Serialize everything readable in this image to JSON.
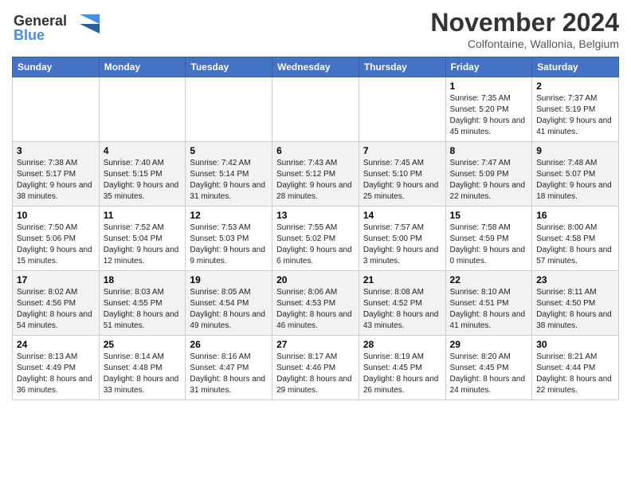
{
  "header": {
    "logo_line1": "General",
    "logo_line2": "Blue",
    "month": "November 2024",
    "location": "Colfontaine, Wallonia, Belgium"
  },
  "columns": [
    "Sunday",
    "Monday",
    "Tuesday",
    "Wednesday",
    "Thursday",
    "Friday",
    "Saturday"
  ],
  "weeks": [
    [
      {
        "day": "",
        "info": ""
      },
      {
        "day": "",
        "info": ""
      },
      {
        "day": "",
        "info": ""
      },
      {
        "day": "",
        "info": ""
      },
      {
        "day": "",
        "info": ""
      },
      {
        "day": "1",
        "info": "Sunrise: 7:35 AM\nSunset: 5:20 PM\nDaylight: 9 hours and 45 minutes."
      },
      {
        "day": "2",
        "info": "Sunrise: 7:37 AM\nSunset: 5:19 PM\nDaylight: 9 hours and 41 minutes."
      }
    ],
    [
      {
        "day": "3",
        "info": "Sunrise: 7:38 AM\nSunset: 5:17 PM\nDaylight: 9 hours and 38 minutes."
      },
      {
        "day": "4",
        "info": "Sunrise: 7:40 AM\nSunset: 5:15 PM\nDaylight: 9 hours and 35 minutes."
      },
      {
        "day": "5",
        "info": "Sunrise: 7:42 AM\nSunset: 5:14 PM\nDaylight: 9 hours and 31 minutes."
      },
      {
        "day": "6",
        "info": "Sunrise: 7:43 AM\nSunset: 5:12 PM\nDaylight: 9 hours and 28 minutes."
      },
      {
        "day": "7",
        "info": "Sunrise: 7:45 AM\nSunset: 5:10 PM\nDaylight: 9 hours and 25 minutes."
      },
      {
        "day": "8",
        "info": "Sunrise: 7:47 AM\nSunset: 5:09 PM\nDaylight: 9 hours and 22 minutes."
      },
      {
        "day": "9",
        "info": "Sunrise: 7:48 AM\nSunset: 5:07 PM\nDaylight: 9 hours and 18 minutes."
      }
    ],
    [
      {
        "day": "10",
        "info": "Sunrise: 7:50 AM\nSunset: 5:06 PM\nDaylight: 9 hours and 15 minutes."
      },
      {
        "day": "11",
        "info": "Sunrise: 7:52 AM\nSunset: 5:04 PM\nDaylight: 9 hours and 12 minutes."
      },
      {
        "day": "12",
        "info": "Sunrise: 7:53 AM\nSunset: 5:03 PM\nDaylight: 9 hours and 9 minutes."
      },
      {
        "day": "13",
        "info": "Sunrise: 7:55 AM\nSunset: 5:02 PM\nDaylight: 9 hours and 6 minutes."
      },
      {
        "day": "14",
        "info": "Sunrise: 7:57 AM\nSunset: 5:00 PM\nDaylight: 9 hours and 3 minutes."
      },
      {
        "day": "15",
        "info": "Sunrise: 7:58 AM\nSunset: 4:59 PM\nDaylight: 9 hours and 0 minutes."
      },
      {
        "day": "16",
        "info": "Sunrise: 8:00 AM\nSunset: 4:58 PM\nDaylight: 8 hours and 57 minutes."
      }
    ],
    [
      {
        "day": "17",
        "info": "Sunrise: 8:02 AM\nSunset: 4:56 PM\nDaylight: 8 hours and 54 minutes."
      },
      {
        "day": "18",
        "info": "Sunrise: 8:03 AM\nSunset: 4:55 PM\nDaylight: 8 hours and 51 minutes."
      },
      {
        "day": "19",
        "info": "Sunrise: 8:05 AM\nSunset: 4:54 PM\nDaylight: 8 hours and 49 minutes."
      },
      {
        "day": "20",
        "info": "Sunrise: 8:06 AM\nSunset: 4:53 PM\nDaylight: 8 hours and 46 minutes."
      },
      {
        "day": "21",
        "info": "Sunrise: 8:08 AM\nSunset: 4:52 PM\nDaylight: 8 hours and 43 minutes."
      },
      {
        "day": "22",
        "info": "Sunrise: 8:10 AM\nSunset: 4:51 PM\nDaylight: 8 hours and 41 minutes."
      },
      {
        "day": "23",
        "info": "Sunrise: 8:11 AM\nSunset: 4:50 PM\nDaylight: 8 hours and 38 minutes."
      }
    ],
    [
      {
        "day": "24",
        "info": "Sunrise: 8:13 AM\nSunset: 4:49 PM\nDaylight: 8 hours and 36 minutes."
      },
      {
        "day": "25",
        "info": "Sunrise: 8:14 AM\nSunset: 4:48 PM\nDaylight: 8 hours and 33 minutes."
      },
      {
        "day": "26",
        "info": "Sunrise: 8:16 AM\nSunset: 4:47 PM\nDaylight: 8 hours and 31 minutes."
      },
      {
        "day": "27",
        "info": "Sunrise: 8:17 AM\nSunset: 4:46 PM\nDaylight: 8 hours and 29 minutes."
      },
      {
        "day": "28",
        "info": "Sunrise: 8:19 AM\nSunset: 4:45 PM\nDaylight: 8 hours and 26 minutes."
      },
      {
        "day": "29",
        "info": "Sunrise: 8:20 AM\nSunset: 4:45 PM\nDaylight: 8 hours and 24 minutes."
      },
      {
        "day": "30",
        "info": "Sunrise: 8:21 AM\nSunset: 4:44 PM\nDaylight: 8 hours and 22 minutes."
      }
    ]
  ]
}
